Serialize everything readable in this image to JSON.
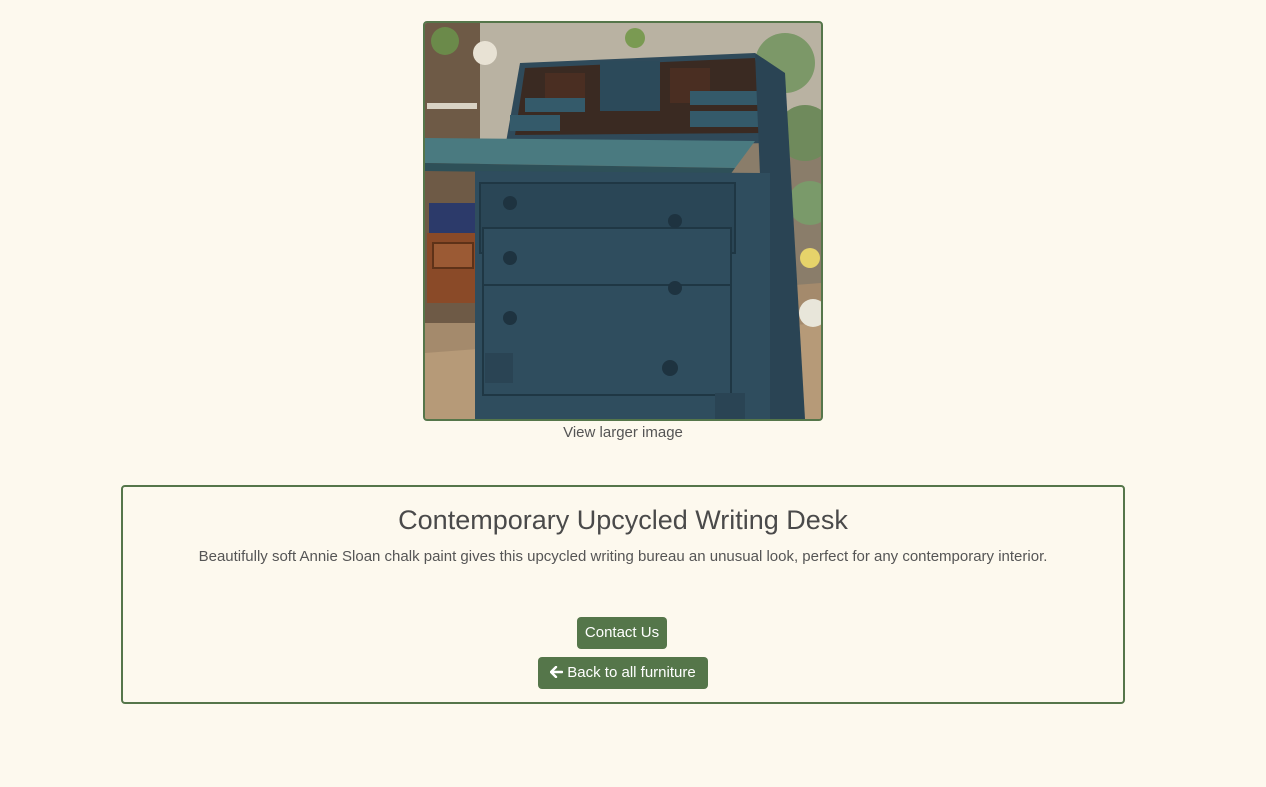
{
  "product": {
    "image_alt": "Blue painted upcycled writing bureau with drop-front desk and drawers",
    "view_larger_label": "View larger image",
    "title": "Contemporary Upcycled Writing Desk",
    "description": "Beautifully soft Annie Sloan chalk paint gives this upcycled writing bureau an unusual look, perfect for any contemporary interior."
  },
  "actions": {
    "contact_label": "Contact Us",
    "back_icon": "arrow-left-icon",
    "back_label": "Back to all furniture"
  },
  "colors": {
    "background": "#fdf9ee",
    "accent": "#55764a",
    "text": "#4a4a4a"
  }
}
